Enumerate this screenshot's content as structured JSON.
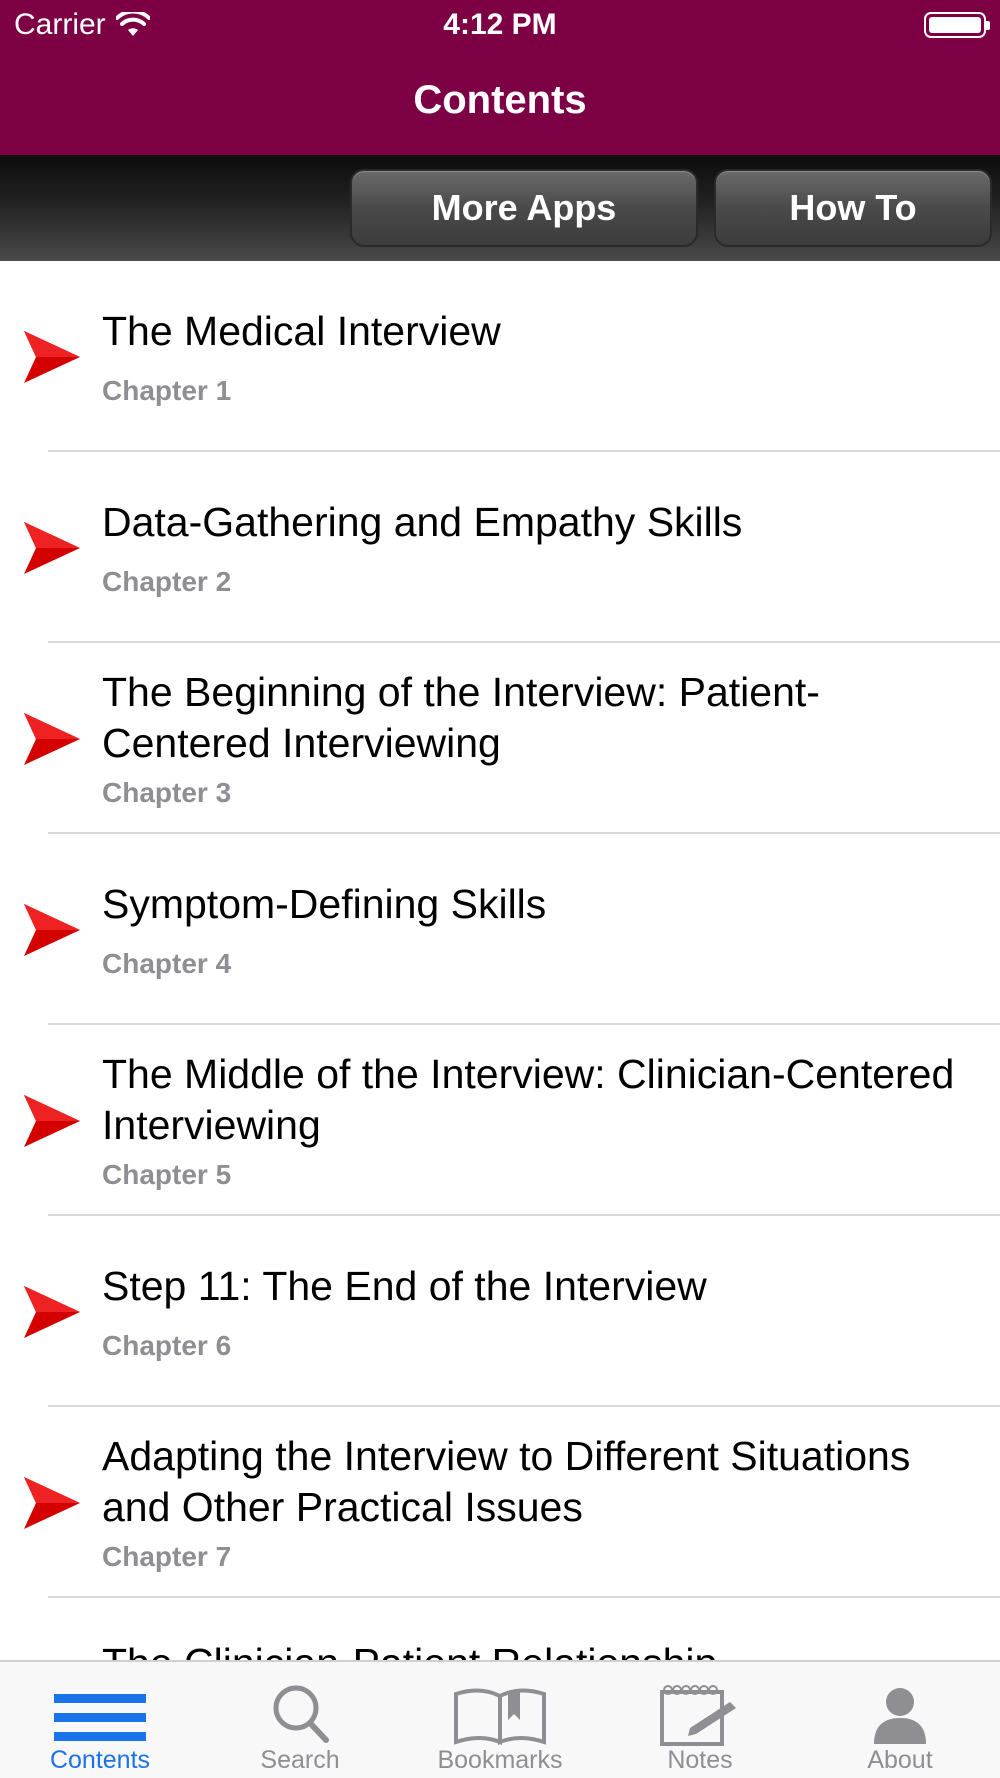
{
  "status_bar": {
    "carrier": "Carrier",
    "time": "4:12 PM"
  },
  "nav": {
    "title": "Contents"
  },
  "toolbar": {
    "more_apps": "More Apps",
    "how_to": "How To"
  },
  "chapters": [
    {
      "title": "The Medical Interview",
      "subtitle": "Chapter 1"
    },
    {
      "title": "Data-Gathering and Empathy Skills",
      "subtitle": "Chapter 2"
    },
    {
      "title": "The Beginning of the Interview: Patient-Centered Interviewing",
      "subtitle": "Chapter 3"
    },
    {
      "title": "Symptom-Defining Skills",
      "subtitle": "Chapter 4"
    },
    {
      "title": "The Middle of the Interview: Clinician-Centered Interviewing",
      "subtitle": "Chapter 5"
    },
    {
      "title": "Step 11: The End of the Interview",
      "subtitle": "Chapter 6"
    },
    {
      "title": "Adapting the Interview to Different Situations and Other Practical Issues",
      "subtitle": "Chapter 7"
    },
    {
      "title": "The Clinician-Patient Relationship",
      "subtitle": ""
    }
  ],
  "tabs": [
    {
      "label": "Contents",
      "icon": "list-icon",
      "active": true
    },
    {
      "label": "Search",
      "icon": "search-icon",
      "active": false
    },
    {
      "label": "Bookmarks",
      "icon": "book-icon",
      "active": false
    },
    {
      "label": "Notes",
      "icon": "notepad-icon",
      "active": false
    },
    {
      "label": "About",
      "icon": "person-icon",
      "active": false
    }
  ],
  "colors": {
    "nav_bg": "#7d0044",
    "arrow": "#d40000",
    "active_tab": "#1a73e8",
    "inactive_tab": "#8e8e93"
  }
}
